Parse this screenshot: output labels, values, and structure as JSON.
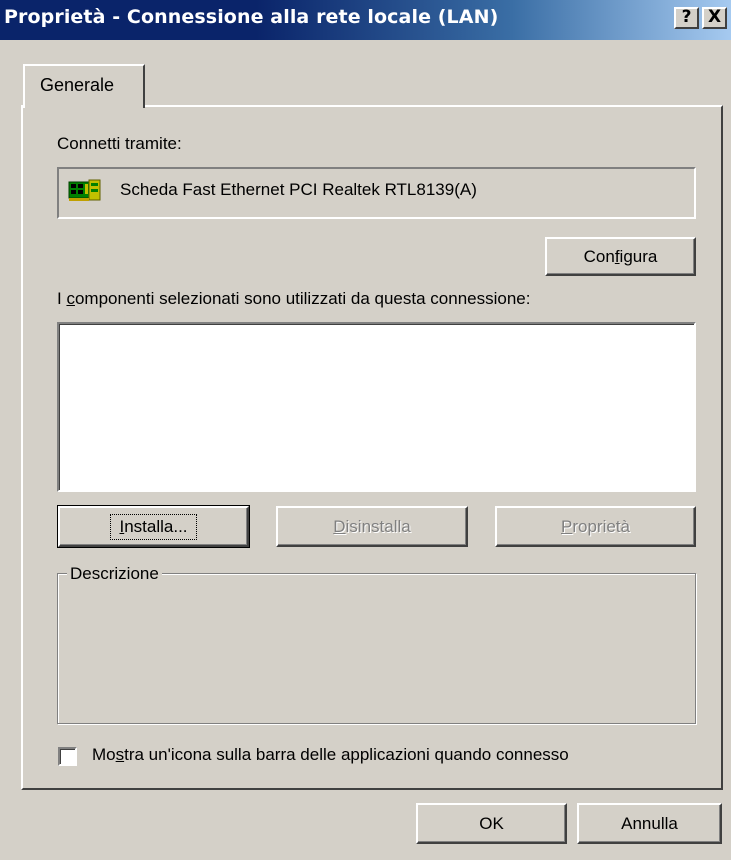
{
  "window": {
    "title": "Proprietà - Connessione alla rete locale (LAN)",
    "help_button": "?",
    "close_button": "X"
  },
  "tabs": [
    {
      "label": "Generale",
      "selected": true
    }
  ],
  "connect_via": {
    "label": "Connetti tramite:",
    "adapter_name": "Scheda Fast Ethernet PCI Realtek RTL8139(A)",
    "adapter_icon": "network-card-icon",
    "configure_button": {
      "pre": "Con",
      "accel": "f",
      "post": "igura"
    }
  },
  "components": {
    "label": {
      "pre": "I ",
      "accel": "c",
      "post": "omponenti selezionati sono utilizzati da questa connessione:"
    },
    "items": [],
    "buttons": {
      "install": {
        "accel": "I",
        "post": "nstalla...",
        "enabled": true
      },
      "uninstall": {
        "accel": "D",
        "post": "isinstalla",
        "enabled": false
      },
      "properties": {
        "accel": "P",
        "post": "roprietà",
        "enabled": false
      }
    }
  },
  "description": {
    "label": "Descrizione",
    "text": ""
  },
  "show_icon": {
    "pre": "Mo",
    "accel": "s",
    "post": "tra un'icona sulla barra delle applicazioni quando connesso",
    "checked": false
  },
  "footer": {
    "ok_label": "OK",
    "cancel_label": "Annulla"
  },
  "colors": {
    "face": "#d4d0c8",
    "title_start": "#0a246a",
    "title_end": "#a6caf0",
    "disabled_text": "#808080"
  }
}
